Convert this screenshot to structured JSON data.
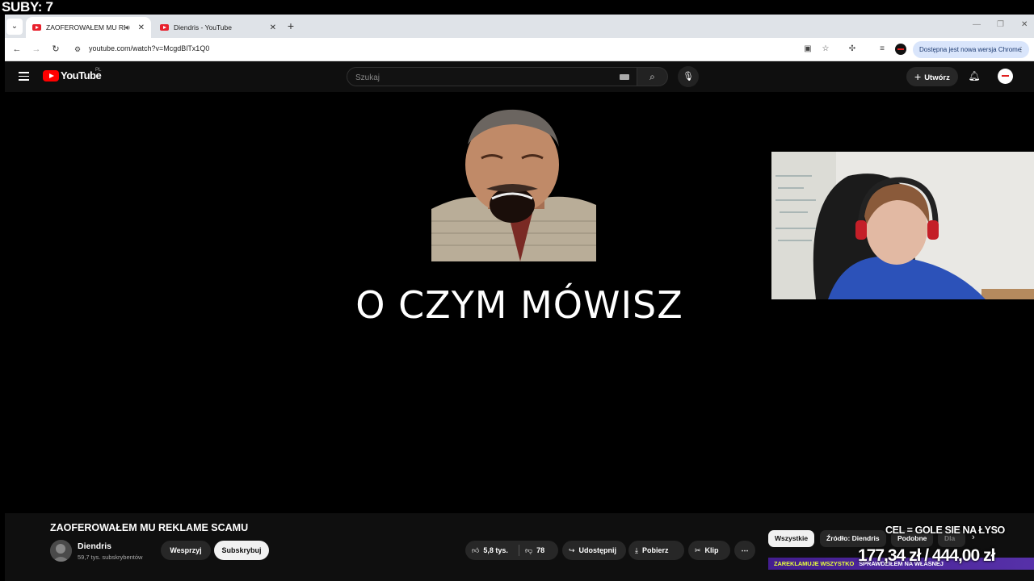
{
  "overlay": {
    "subs_counter": "SUBY: 7",
    "goal": "CEL = GOLE SIE NA ŁYSO",
    "donation": "177,34 zł / 444,00 zł",
    "ticker_a": "ZAREKLAMUJE WSZYSTKO",
    "ticker_b": "SPRAWDZIŁEM NA WŁASNEJ"
  },
  "browser": {
    "tabs": [
      {
        "title": "ZAOFEROWAŁEM MU REKL",
        "active": true
      },
      {
        "title": "Diendris - YouTube",
        "active": false
      }
    ],
    "url": "youtube.com/watch?v=McgdBlTx1Q0",
    "update_label": "Dostępna jest nowa wersja Chrome"
  },
  "youtube": {
    "logo_text": "YouTube",
    "region": "PL",
    "search_placeholder": "Szukaj",
    "create_label": "Utwórz"
  },
  "video": {
    "caption": "O CZYM MÓWISZ"
  },
  "details": {
    "title": "ZAOFEROWAŁEM MU REKLAME SCAMU",
    "channel_name": "Diendris",
    "subscribers": "59,7 tys. subskrybentów",
    "support_label": "Wesprzyj",
    "subscribe_label": "Subskrybuj",
    "likes": "5,8 tys.",
    "dislikes": "78",
    "share_label": "Udostępnij",
    "download_label": "Pobierz",
    "clip_label": "Klip",
    "chips": [
      "Wszystkie",
      "Źródło: Diendris",
      "Podobne",
      "Dla"
    ]
  },
  "colors": {
    "yt_red": "#ff0000",
    "page_bg": "#0f0f0f",
    "pill_bg": "#272727",
    "ticker_yellow": "#e7ff3a"
  }
}
